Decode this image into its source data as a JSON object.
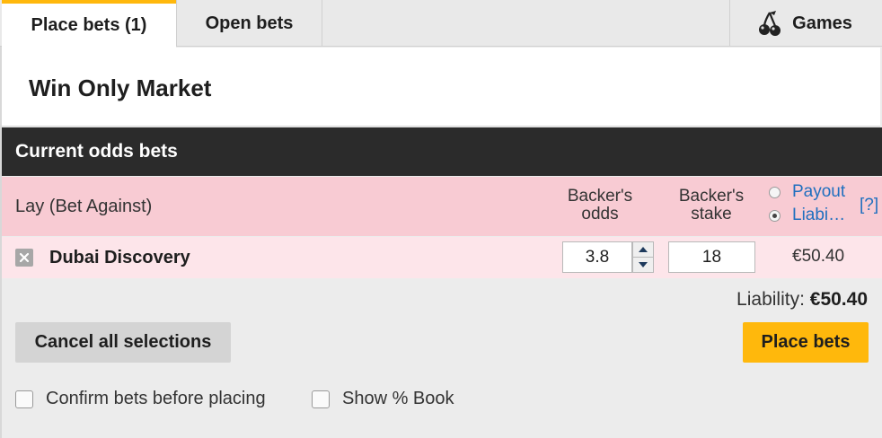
{
  "tabs": {
    "place_bets": "Place bets (1)",
    "open_bets": "Open bets",
    "games": "Games",
    "games_icon": "cherries-icon",
    "active_accent": "#ffb80c"
  },
  "market": {
    "title": "Win Only Market"
  },
  "section": {
    "title": "Current odds bets"
  },
  "columns": {
    "lay_label": "Lay (Bet Against)",
    "backers_odds_line1": "Backer's",
    "backers_odds_line2": "odds",
    "backers_stake_line1": "Backer's",
    "backers_stake_line2": "stake",
    "payout_label": "Payout",
    "liability_label": "Liabi…",
    "help": "[?]",
    "selected_option": "Liability"
  },
  "selection": {
    "runner": "Dubai Discovery",
    "odds": "3.8",
    "stake": "18",
    "liability": "€50.40"
  },
  "summary": {
    "liability_label": "Liability:",
    "liability_value": "€50.40"
  },
  "actions": {
    "cancel": "Cancel all selections",
    "place": "Place bets"
  },
  "options": {
    "confirm_bets": "Confirm bets before placing",
    "confirm_bets_checked": false,
    "show_book": "Show % Book",
    "show_book_checked": false
  },
  "colors": {
    "header_dark": "#2b2b2b",
    "lay_pink": "#f8cbd3",
    "lay_row": "#fde5ea",
    "link_blue": "#1f6fbf"
  }
}
